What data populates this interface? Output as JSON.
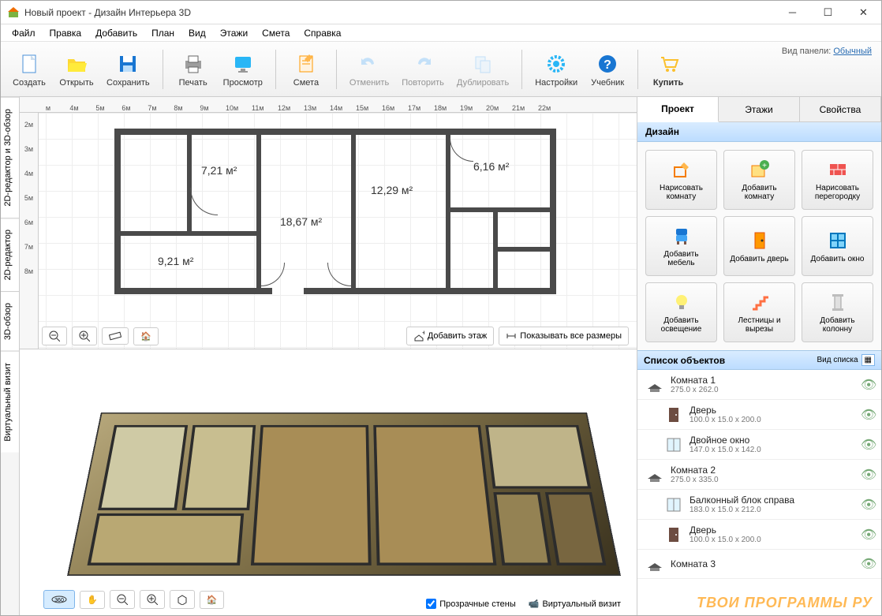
{
  "window": {
    "title": "Новый проект - Дизайн Интерьера 3D"
  },
  "menu": [
    "Файл",
    "Правка",
    "Добавить",
    "План",
    "Вид",
    "Этажи",
    "Смета",
    "Справка"
  ],
  "panel_mode": {
    "label": "Вид панели:",
    "value": "Обычный"
  },
  "toolbar": {
    "create": "Создать",
    "open": "Открыть",
    "save": "Сохранить",
    "print": "Печать",
    "preview": "Просмотр",
    "estimate": "Смета",
    "undo": "Отменить",
    "redo": "Повторить",
    "duplicate": "Дублировать",
    "settings": "Настройки",
    "tutorial": "Учебник",
    "buy": "Купить"
  },
  "sidetabs": {
    "combo": "2D-редактор и 3D-обзор",
    "editor2d": "2D-редактор",
    "view3d": "3D-обзор",
    "virtual": "Виртуальный визит"
  },
  "ruler_h": [
    "м",
    "4м",
    "5м",
    "6м",
    "7м",
    "8м",
    "9м",
    "10м",
    "11м",
    "12м",
    "13м",
    "14м",
    "15м",
    "16м",
    "17м",
    "18м",
    "19м",
    "20м",
    "21м",
    "22м"
  ],
  "ruler_v": [
    "2м",
    "3м",
    "4м",
    "5м",
    "6м",
    "7м",
    "8м"
  ],
  "rooms": {
    "r1": "7,21 м²",
    "r2": "18,67 м²",
    "r3": "12,29 м²",
    "r4": "6,16 м²",
    "r5": "9,21 м²"
  },
  "plan_actions": {
    "add_floor": "Добавить этаж",
    "show_dims": "Показывать все размеры"
  },
  "view3d_actions": {
    "transparent": "Прозрачные стены",
    "record": "Виртуальный визит"
  },
  "sidebar": {
    "tabs": {
      "project": "Проект",
      "floors": "Этажи",
      "props": "Свойства"
    },
    "design": "Дизайн",
    "buttons": {
      "draw_room": "Нарисовать комнату",
      "add_room": "Добавить комнату",
      "draw_partition": "Нарисовать перегородку",
      "add_furniture": "Добавить мебель",
      "add_door": "Добавить дверь",
      "add_window": "Добавить окно",
      "add_light": "Добавить освещение",
      "stairs": "Лестницы и вырезы",
      "add_column": "Добавить колонну"
    },
    "objlist_title": "Список объектов",
    "view_list": "Вид списка",
    "objects": [
      {
        "name": "Комната 1",
        "dim": "275.0 x 262.0",
        "type": "room"
      },
      {
        "name": "Дверь",
        "dim": "100.0 x 15.0 x 200.0",
        "type": "door",
        "indent": true
      },
      {
        "name": "Двойное окно",
        "dim": "147.0 x 15.0 x 142.0",
        "type": "window",
        "indent": true
      },
      {
        "name": "Комната 2",
        "dim": "275.0 x 335.0",
        "type": "room"
      },
      {
        "name": "Балконный блок справа",
        "dim": "183.0 x 15.0 x 212.0",
        "type": "window",
        "indent": true
      },
      {
        "name": "Дверь",
        "dim": "100.0 x 15.0 x 200.0",
        "type": "door",
        "indent": true
      },
      {
        "name": "Комната 3",
        "dim": "",
        "type": "room"
      }
    ]
  },
  "watermark": "ТВОИ ПРОГРАММЫ РУ"
}
